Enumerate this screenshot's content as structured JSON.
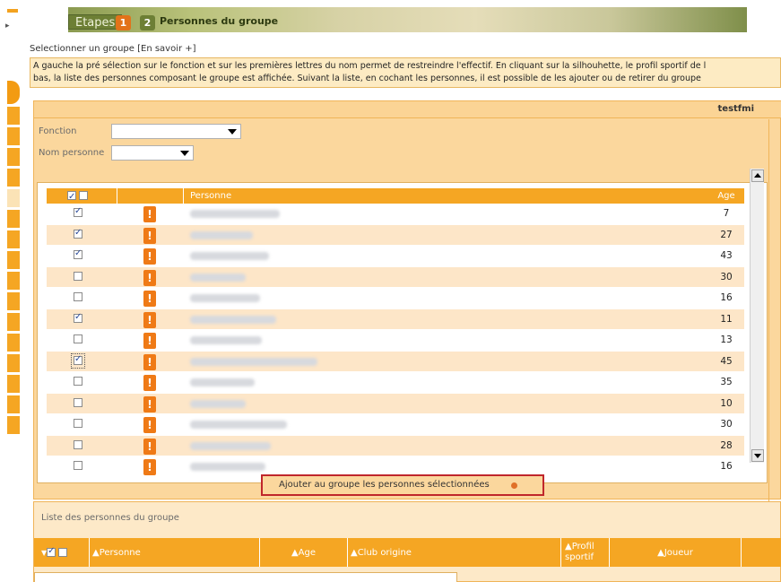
{
  "header": {
    "etapes_label": "Etapes",
    "step1_num": "1",
    "step2_num": "2",
    "step_title": "Personnes du groupe"
  },
  "select_group": {
    "text": "Selectionner un groupe",
    "link": "[En savoir +]"
  },
  "info": {
    "line1": "A gauche la pré sélection sur le fonction et sur les premières lettres du nom permet de restreindre l'effectif. En cliquant sur la silhouhette, le profil sportif de l",
    "line2": "bas, la liste des personnes composant le groupe est affichée. Suivant la liste, en cochant les personnes, il est possible de les ajouter ou de retirer du groupe"
  },
  "user": "testfmi",
  "filters": {
    "fonction_label": "Fonction",
    "fonction_value": "",
    "nom_label": "Nom personne",
    "nom_value": ""
  },
  "grid": {
    "col_personne": "Personne",
    "col_age": "Age",
    "rows": [
      {
        "checked": true,
        "age": "7",
        "name_len": 100
      },
      {
        "checked": true,
        "age": "27",
        "name_len": 70
      },
      {
        "checked": true,
        "age": "43",
        "name_len": 88
      },
      {
        "checked": false,
        "age": "30",
        "name_len": 62
      },
      {
        "checked": false,
        "age": "16",
        "name_len": 78
      },
      {
        "checked": true,
        "age": "11",
        "name_len": 96
      },
      {
        "checked": false,
        "age": "13",
        "name_len": 80
      },
      {
        "checked": true,
        "age": "45",
        "name_len": 142
      },
      {
        "checked": false,
        "age": "35",
        "name_len": 72
      },
      {
        "checked": false,
        "age": "10",
        "name_len": 62
      },
      {
        "checked": false,
        "age": "30",
        "name_len": 108
      },
      {
        "checked": false,
        "age": "28",
        "name_len": 90
      },
      {
        "checked": false,
        "age": "16",
        "name_len": 84
      }
    ]
  },
  "add_button_label": "Ajouter au groupe les personnes sélectionnées",
  "list": {
    "title": "Liste des personnes du groupe",
    "col_personne": "▲Personne",
    "col_age": "▲Age",
    "col_club": "▲Club origine",
    "col_profil_1": "▲Profil",
    "col_profil_2": "sportif",
    "col_joueur": "▲Joueur"
  },
  "colors": {
    "accent": "#f5a623",
    "panel": "#fbd79d",
    "warn": "#ef7a16",
    "highlight_border": "#c0262b"
  }
}
